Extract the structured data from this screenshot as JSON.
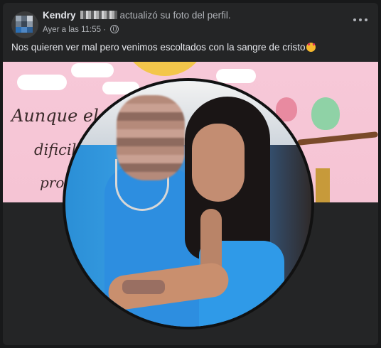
{
  "post": {
    "author": "Kendry",
    "action": "actualizó su foto del perfil.",
    "timestamp": "Ayer a las 11:55",
    "audience_icon": "globe-icon",
    "more_icon": "more-horizontal-icon",
    "caption": "Nos quieren ver mal pero venimos escoltados con la sangre de cristo",
    "caption_emoji": "smiling-face-with-hearts"
  },
  "cover": {
    "lines": [
      "Aunque el",
      "dificil",
      "pro"
    ]
  },
  "colors": {
    "card": "#242526",
    "page": "#18191a",
    "text_primary": "#e4e6eb",
    "text_secondary": "#b0b3b8",
    "cover_bg": "#f5c4d4",
    "shirt_blue": "#2d8ee0"
  }
}
